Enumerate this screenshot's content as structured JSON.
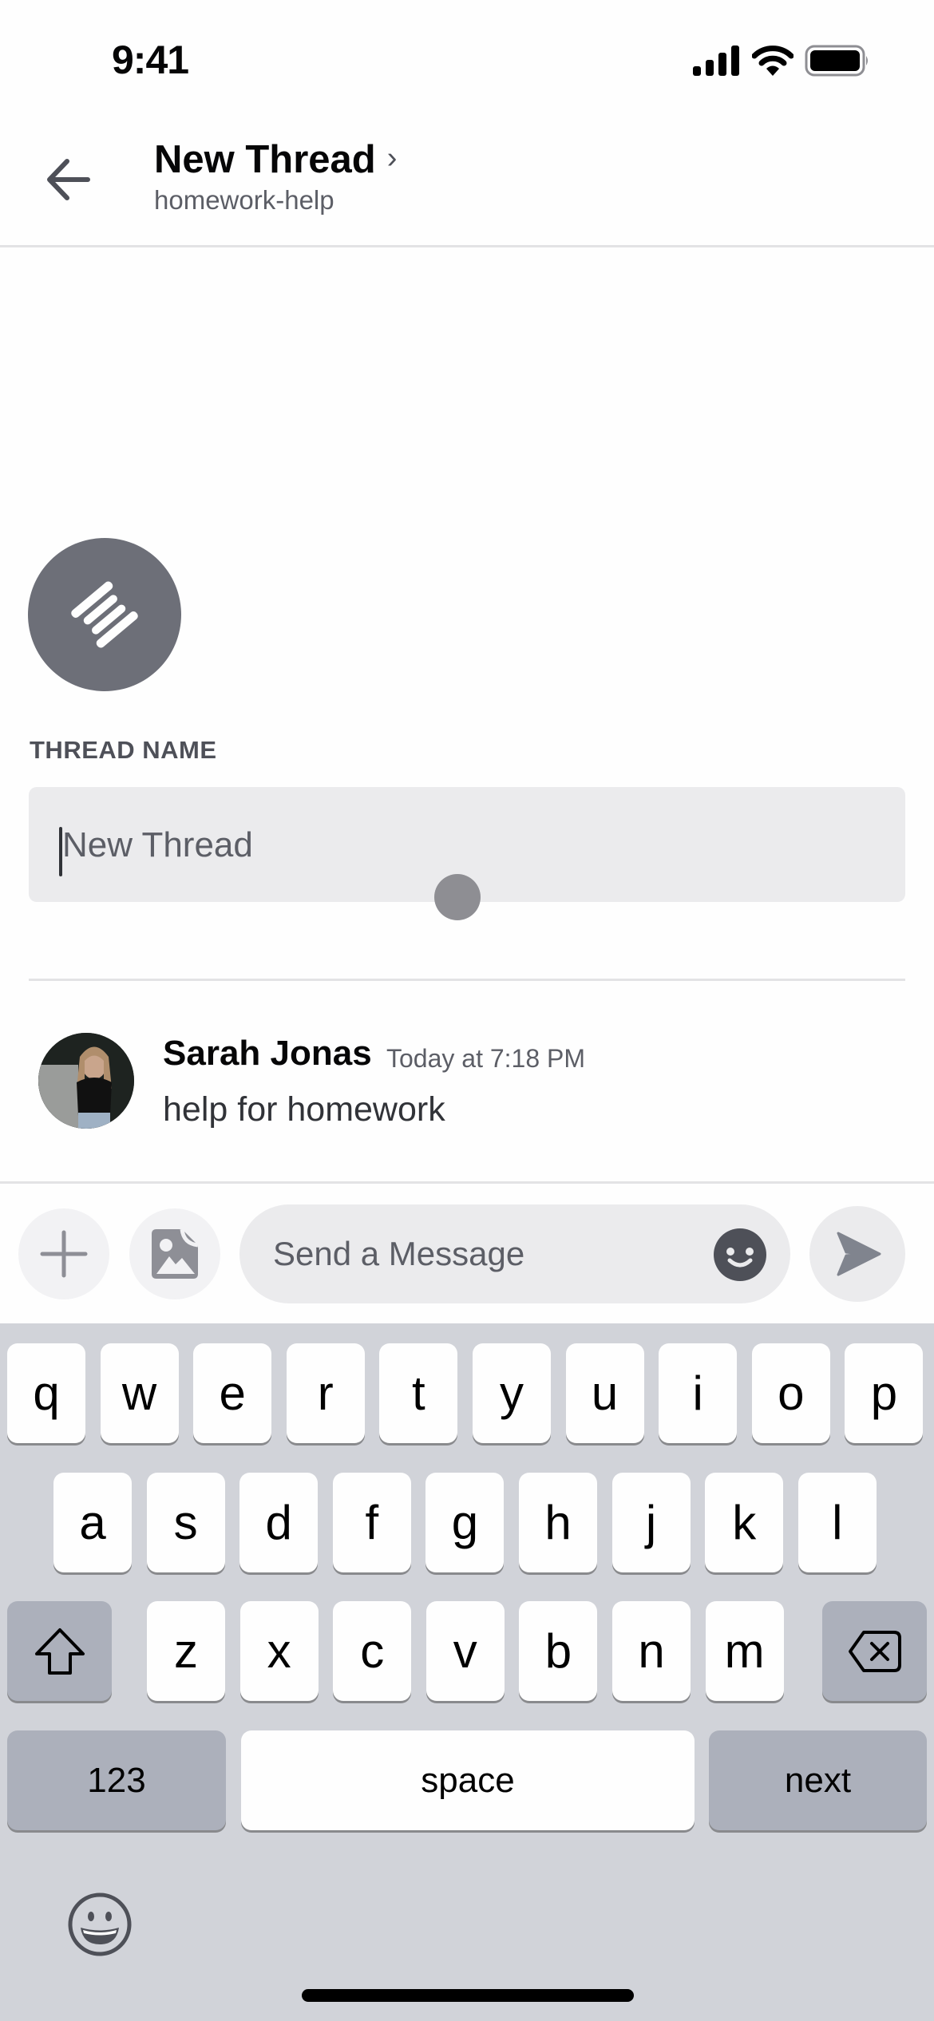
{
  "status_bar": {
    "time": "9:41",
    "icons": [
      "cellular-signal-icon",
      "wifi-icon",
      "battery-icon"
    ]
  },
  "header": {
    "back_icon": "arrow-left-icon",
    "title": "New Thread",
    "title_chevron": "›",
    "subtitle": "homework-help"
  },
  "thread": {
    "icon": "thread-icon",
    "section_label": "THREAD NAME",
    "name_input": {
      "value": "",
      "placeholder": "New Thread"
    }
  },
  "message": {
    "author": "Sarah Jonas",
    "timestamp": "Today at 7:18 PM",
    "text": "help for homework",
    "avatar": "user-avatar-photo"
  },
  "composer": {
    "add_icon": "plus-icon",
    "gallery_icon": "image-icon",
    "placeholder": "Send a Message",
    "emoji_icon": "emoji-icon",
    "send_icon": "send-icon"
  },
  "keyboard": {
    "row1": [
      "q",
      "w",
      "e",
      "r",
      "t",
      "y",
      "u",
      "i",
      "o",
      "p"
    ],
    "row2": [
      "a",
      "s",
      "d",
      "f",
      "g",
      "h",
      "j",
      "k",
      "l"
    ],
    "row3": [
      "z",
      "x",
      "c",
      "v",
      "b",
      "n",
      "m"
    ],
    "shift_icon": "shift-icon",
    "delete_icon": "backspace-icon",
    "numbers_label": "123",
    "space_label": "space",
    "return_label": "next",
    "emoji_icon": "emoji-keyboard-icon"
  },
  "colors": {
    "thread_icon_bg": "#6d6f78",
    "input_bg": "#ebebed",
    "keyboard_bg": "#d1d3d9",
    "special_key_bg": "#acb0bb"
  }
}
